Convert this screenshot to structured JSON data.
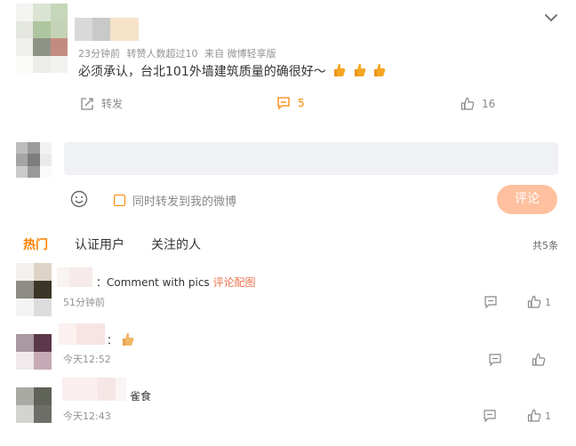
{
  "post": {
    "meta": [
      "23分钟前",
      "转赞人数超过10",
      "来自 微博轻享版"
    ],
    "text": "必须承认，台北101外墙建筑质量的确很好～",
    "emojis": [
      "thumbs-up-icon",
      "thumbs-up-icon",
      "thumbs-up-icon"
    ],
    "actions": {
      "repost_label": "转发",
      "comment_count": "5",
      "like_count": "16"
    }
  },
  "composer": {
    "repost_checkbox_label": "同时转发到我的微博",
    "submit_label": "评论"
  },
  "tabs": [
    "热门",
    "认证用户",
    "关注的人"
  ],
  "total": "共5条",
  "comments": [
    {
      "prefix": "：Comment with pics",
      "link": "评论配图",
      "time": "51分钟前",
      "like_count": "1"
    },
    {
      "prefix": "：",
      "emoji": "thumbs-up-icon",
      "time": "今天12:52",
      "like_count": ""
    },
    {
      "prefix": "雀食",
      "time": "今天12:43",
      "like_count": "1"
    }
  ],
  "colors": {
    "accent": "#ff8200",
    "link": "#eb7350",
    "submit_bg": "#ffc09f"
  }
}
